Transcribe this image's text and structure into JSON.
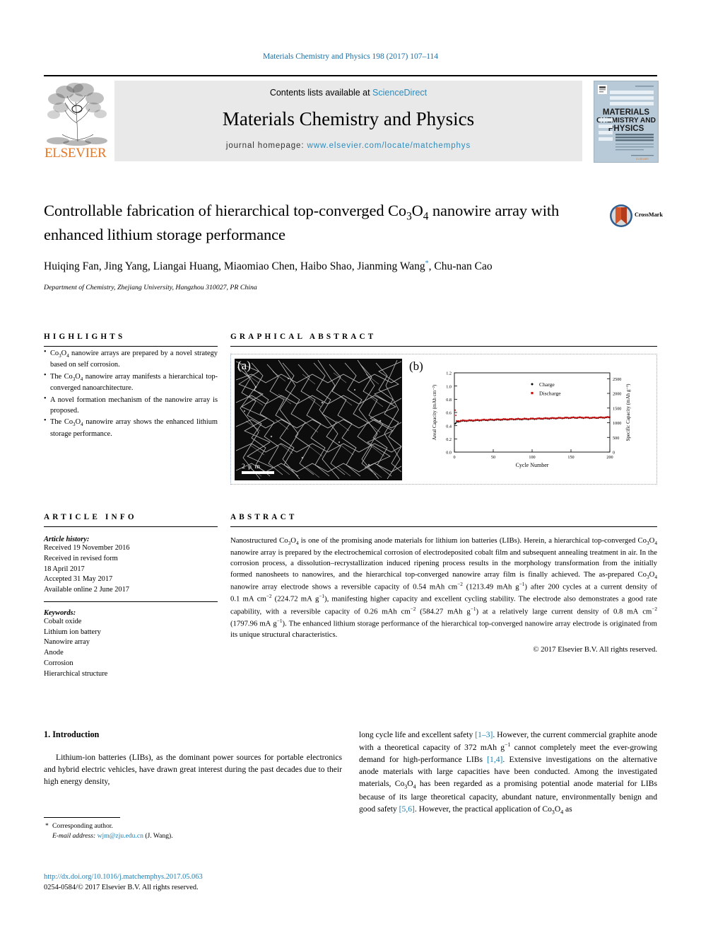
{
  "running_head": "Materials Chemistry and Physics 198 (2017) 107–114",
  "masthead": {
    "contents_prefix": "Contents lists available at ",
    "sciencedirect": "ScienceDirect",
    "journal_title": "Materials Chemistry and Physics",
    "homepage_prefix": "journal homepage: ",
    "homepage_url": "www.elsevier.com/locate/matchemphys",
    "publisher": "ELSEVIER",
    "cover_title_line1": "MATERIALS",
    "cover_title_line2": "CHEMISTRY AND",
    "cover_title_line3": "PHYSICS",
    "link_color": "#2b8cbe",
    "panel_bg": "#e9e9e9"
  },
  "article": {
    "title_part1": "Controllable fabrication of hierarchical top-converged Co",
    "title_sub1": "3",
    "title_part2": "O",
    "title_sub2": "4",
    "title_part3": " nanowire array with enhanced lithium storage performance",
    "authors": "Huiqing Fan, Jing Yang, Liangai Huang, Miaomiao Chen, Haibo Shao, Jianming Wang",
    "author_marker": "*",
    "authors_cont": ", Chu-nan Cao",
    "affiliation": "Department of Chemistry, Zhejiang University, Hangzhou 310027, PR China",
    "crossmark_label": "CrossMark"
  },
  "highlights": {
    "heading": "HIGHLIGHTS",
    "items": [
      "Co3O4 nanowire arrays are prepared by a novel strategy based on self corrosion.",
      "The Co3O4 nanowire array manifests a hierarchical top-converged nanoarchitecture.",
      "A novel formation mechanism of the nanowire array is proposed.",
      "The Co3O4 nanowire array shows the enhanced lithium storage performance."
    ]
  },
  "graphical_abstract": {
    "heading": "GRAPHICAL ABSTRACT",
    "panel_a_label": "(a)",
    "panel_b_label": "(b)",
    "scalebar_text": "2 μ m"
  },
  "article_info": {
    "heading": "ARTICLE INFO",
    "history_label": "Article history:",
    "history": [
      "Received 19 November 2016",
      "Received in revised form",
      "18 April 2017",
      "Accepted 31 May 2017",
      "Available online 2 June 2017"
    ],
    "keywords_label": "Keywords:",
    "keywords": [
      "Cobalt oxide",
      "Lithium ion battery",
      "Nanowire array",
      "Anode",
      "Corrosion",
      "Hierarchical structure"
    ]
  },
  "abstract": {
    "heading": "ABSTRACT",
    "copyright": "© 2017 Elsevier B.V. All rights reserved."
  },
  "introduction": {
    "heading": "1. Introduction"
  },
  "footnote": {
    "corresponding": "Corresponding author.",
    "email_label": "E-mail address:",
    "email": "wjm@zju.edu.cn",
    "email_owner": "(J. Wang)."
  },
  "footer": {
    "doi": "http://dx.doi.org/10.1016/j.matchemphys.2017.05.063",
    "issn": "0254-0584/© 2017 Elsevier B.V. All rights reserved."
  },
  "chart_data": {
    "type": "scatter",
    "title": "",
    "xlabel": "Cycle Number",
    "ylabel": "Areal Capacity (mAh cm⁻²)",
    "y2label": "Specific Capacity (mAh g⁻¹)",
    "xlim": [
      0,
      200
    ],
    "ylim": [
      0.0,
      1.2
    ],
    "y2lim": [
      0,
      2700
    ],
    "xticks": [
      0,
      50,
      100,
      150,
      200
    ],
    "yticks": [
      "0.0",
      "0.2",
      "0.4",
      "0.6",
      "0.8",
      "1.0",
      "1.2"
    ],
    "y2ticks": [
      0,
      500,
      1000,
      1500,
      2000,
      2500
    ],
    "grid": false,
    "legend_position": "top-center",
    "series": [
      {
        "name": "Charge",
        "color": "#000000",
        "marker": "circle",
        "x": [
          1,
          3,
          5,
          8,
          12,
          18,
          25,
          33,
          42,
          52,
          63,
          75,
          88,
          100,
          112,
          125,
          138,
          150,
          160,
          170,
          180,
          190,
          196,
          200
        ],
        "y": [
          0.43,
          0.452,
          0.462,
          0.47,
          0.472,
          0.475,
          0.478,
          0.482,
          0.485,
          0.488,
          0.492,
          0.496,
          0.498,
          0.502,
          0.506,
          0.51,
          0.515,
          0.519,
          0.521,
          0.52,
          0.518,
          0.522,
          0.524,
          0.527
        ]
      },
      {
        "name": "Discharge",
        "color": "#cc1111",
        "marker": "square",
        "x": [
          1,
          3,
          5,
          8,
          12,
          18,
          25,
          33,
          42,
          52,
          63,
          75,
          88,
          100,
          112,
          125,
          138,
          150,
          160,
          170,
          180,
          190,
          196,
          200
        ],
        "y": [
          0.635,
          0.468,
          0.472,
          0.476,
          0.478,
          0.48,
          0.483,
          0.487,
          0.49,
          0.493,
          0.497,
          0.5,
          0.503,
          0.506,
          0.51,
          0.514,
          0.518,
          0.522,
          0.524,
          0.523,
          0.521,
          0.525,
          0.527,
          0.53
        ]
      }
    ]
  }
}
